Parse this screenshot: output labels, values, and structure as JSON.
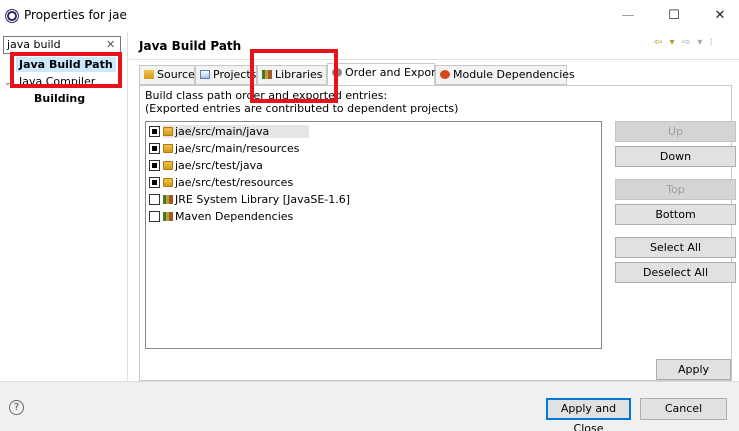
{
  "window": {
    "title": "Properties for jae",
    "min": "—",
    "max": "☐",
    "close": "✕"
  },
  "sidebar": {
    "filter_value": "java build",
    "filter_clear": "✕",
    "items": [
      "Java Build Path",
      "Java Compiler",
      "Building"
    ]
  },
  "page": {
    "title": "Java Build Path",
    "tabs": [
      "Source",
      "Projects",
      "Libraries",
      "Order and Export",
      "Module Dependencies"
    ],
    "active_tab": "Order and Export",
    "description_1": "Build class path order and exported entries:",
    "description_2": "(Exported entries are contributed to dependent projects)",
    "entries": [
      {
        "label": "jae/src/main/java",
        "checked": true,
        "icon": "source-folder-icon"
      },
      {
        "label": "jae/src/main/resources",
        "checked": true,
        "icon": "source-folder-icon"
      },
      {
        "label": "jae/src/test/java",
        "checked": true,
        "icon": "source-folder-icon"
      },
      {
        "label": "jae/src/test/resources",
        "checked": true,
        "icon": "source-folder-icon"
      },
      {
        "label": "JRE System Library [JavaSE-1.6]",
        "checked": false,
        "icon": "library-icon"
      },
      {
        "label": "Maven Dependencies",
        "checked": false,
        "icon": "library-icon"
      }
    ],
    "buttons": {
      "up": "Up",
      "down": "Down",
      "top": "Top",
      "bottom": "Bottom",
      "select_all": "Select All",
      "deselect_all": "Deselect All"
    },
    "apply": "Apply"
  },
  "footer": {
    "help": "?",
    "apply_close": "Apply and Close",
    "cancel": "Cancel"
  },
  "colors": {
    "annotation": "#e8121b",
    "selection": "#cce8ff"
  }
}
